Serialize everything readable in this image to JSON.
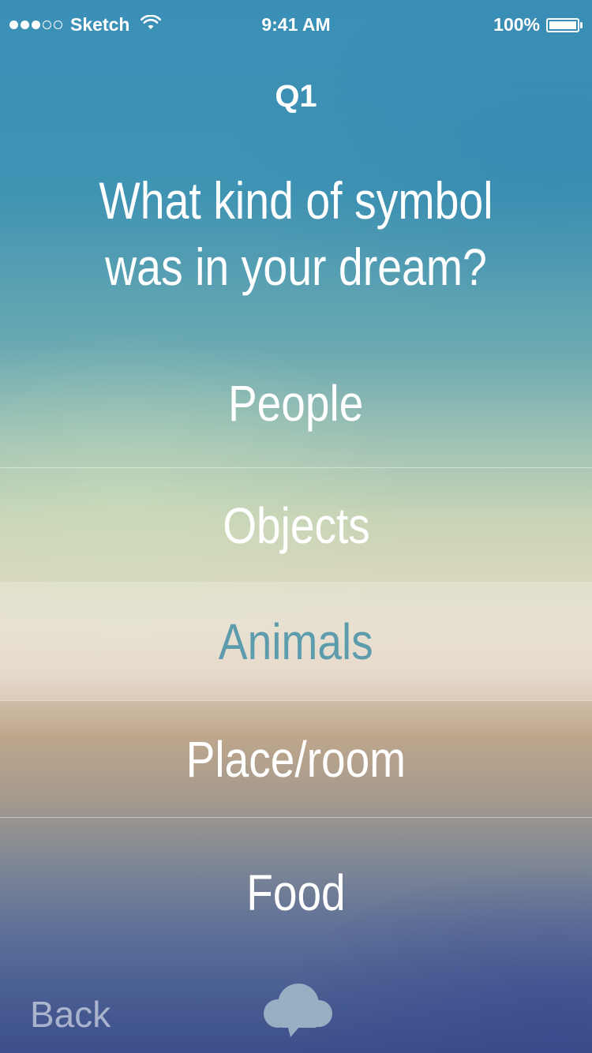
{
  "status_bar": {
    "carrier": "Sketch",
    "time": "9:41 AM",
    "battery": "100%",
    "battery_level": 1.0,
    "signal_bars": 3,
    "signal_total": 5
  },
  "quiz": {
    "number": "Q1",
    "question_line1": "What kind of symbol",
    "question_line2": "was in your dream?",
    "options": [
      {
        "label": "People",
        "selected": false
      },
      {
        "label": "Objects",
        "selected": false
      },
      {
        "label": "Animals",
        "selected": true
      },
      {
        "label": "Place/room",
        "selected": false
      },
      {
        "label": "Food",
        "selected": false
      }
    ],
    "selected_color": "#5c9cad"
  },
  "footer": {
    "back_label": "Back",
    "center_icon": "speech-cloud-icon"
  }
}
